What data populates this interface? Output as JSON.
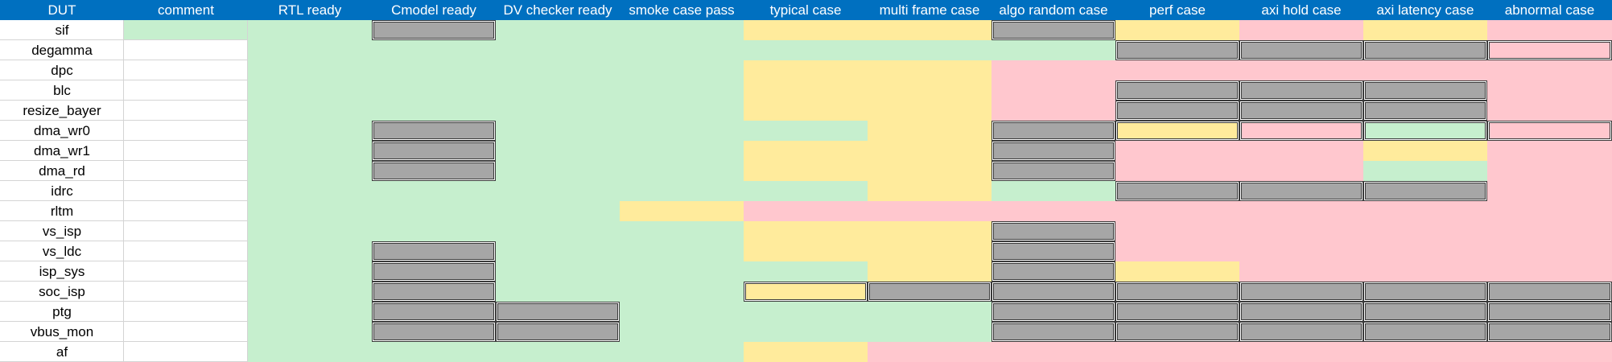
{
  "headers": [
    "DUT",
    "comment",
    "RTL ready",
    "Cmodel ready",
    "DV checker ready",
    "smoke case pass",
    "typical case",
    "multi frame case",
    "algo random case",
    "perf case",
    "axi hold case",
    "axi latency case",
    "abnormal case"
  ],
  "colors": {
    "header_bg": "#0070c0",
    "pass_green": "#c6efce",
    "warn_yellow": "#ffeb9c",
    "fail_red": "#ffc7ce",
    "na_gray": "#a6a6a6"
  },
  "legend": {
    "g": "green",
    "y": "yellow",
    "r": "red",
    "x": "gray",
    "w": "white"
  },
  "rows": [
    {
      "dut": "sif",
      "cells": "wgxggyyxyryr"
    },
    {
      "dut": "degamma",
      "cells": "wggggggg xxxr"
    },
    {
      "dut": "dpc",
      "cells": "wgggggyyrrrrr"
    },
    {
      "dut": "blc",
      "cells": "wgggggyyrxxxr"
    },
    {
      "dut": "resize_bayer",
      "cells": "wgggggyyrxxxr"
    },
    {
      "dut": "dma_wr0",
      "cells": "wgxgggggyxyrgr"
    },
    {
      "dut": "dma_wr1",
      "cells": "wgxggyyxrryr"
    },
    {
      "dut": "dma_rd",
      "cells": "wgxggyyxrrgr"
    },
    {
      "dut": "idrc",
      "cells": "wgggggyggxxxr"
    },
    {
      "dut": "rltm",
      "cells": "wgggyrrrrrrr"
    },
    {
      "dut": "vs_isp",
      "cells": "wgggggyyxrrrr"
    },
    {
      "dut": "vs_ldc",
      "cells": "wgxggyyxrrrr"
    },
    {
      "dut": "isp_sys",
      "cells": "wgxggggyxyrrr"
    },
    {
      "dut": "soc_isp",
      "cells": "wgxggyxxxxxx"
    },
    {
      "dut": "ptg",
      "cells": "wgxxggggxxxxx"
    },
    {
      "dut": "vbus_mon",
      "cells": "wgxxggggxxxxx"
    },
    {
      "dut": "af",
      "cells": "wggggggyrrrrr"
    }
  ]
}
